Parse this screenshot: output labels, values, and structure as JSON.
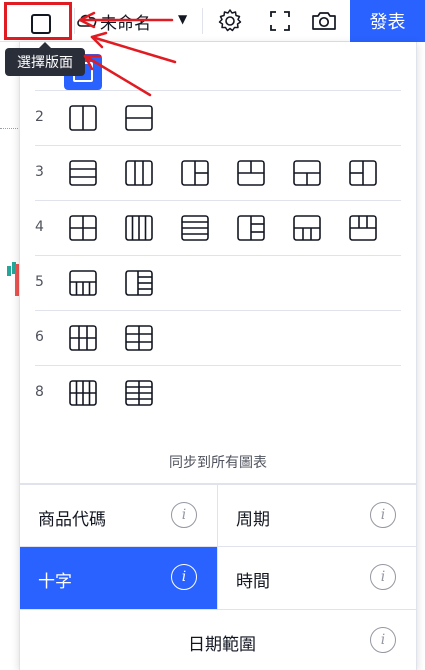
{
  "toolbar": {
    "layout_name": "未命名",
    "publish_label": "發表",
    "icons": [
      "square-layout-icon",
      "cloud-icon",
      "chevron-down-icon",
      "gear-icon",
      "fullscreen-icon",
      "camera-icon"
    ]
  },
  "tooltip": {
    "text": "選擇版面"
  },
  "layouts": {
    "rows": [
      {
        "count": "2",
        "options": [
          "2v",
          "2h"
        ]
      },
      {
        "count": "3",
        "options": [
          "3h",
          "3v",
          "3-left-1-right-2",
          "3-top-2-bottom-1",
          "3-top-1-bottom-2",
          "3-left-2-right-1"
        ]
      },
      {
        "count": "4",
        "options": [
          "4-grid",
          "4v",
          "4h",
          "4-left-1-right-3",
          "4-top-1-bottom-3",
          "4-top-3-bottom-1"
        ]
      },
      {
        "count": "5",
        "options": [
          "5-top-1-bottom-4",
          "5-left-1-right-4"
        ]
      },
      {
        "count": "6",
        "options": [
          "6-grid-3x2",
          "6-grid-2x3"
        ]
      },
      {
        "count": "8",
        "options": [
          "8-grid-4x2",
          "8-grid-2x4"
        ]
      }
    ],
    "selected": "1"
  },
  "sync": {
    "title": "同步到所有圖表",
    "options": [
      {
        "label": "商品代碼",
        "active": false
      },
      {
        "label": "周期",
        "active": false
      },
      {
        "label": "十字",
        "active": true
      },
      {
        "label": "時間",
        "active": false
      },
      {
        "label": "日期範圍",
        "active": false
      }
    ],
    "info_glyph": "i"
  },
  "colors": {
    "accent": "#2962ff",
    "annotation": "#e01b22",
    "tooltip_bg": "#2a2e39"
  }
}
